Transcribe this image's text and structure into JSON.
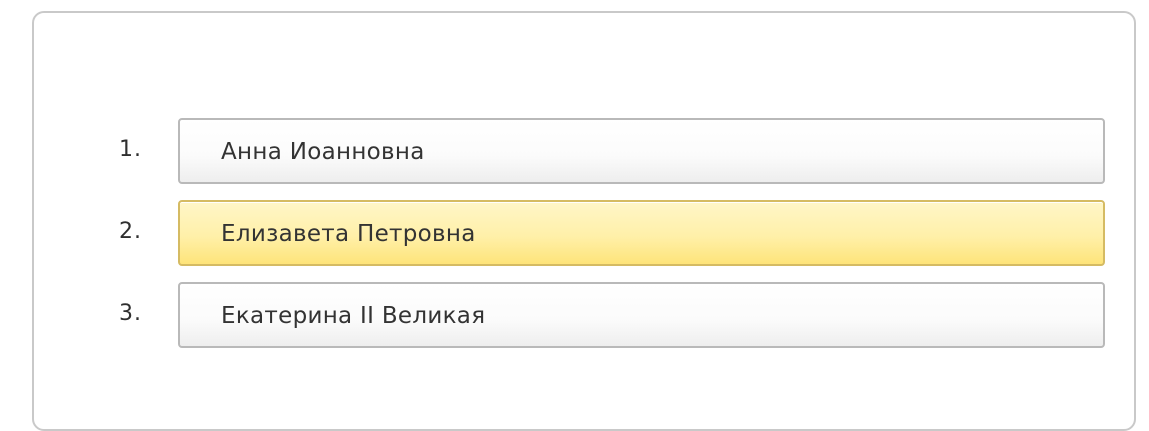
{
  "ordering_question": {
    "items": [
      {
        "number": "1.",
        "label": "Анна Иоанновна",
        "state": "default"
      },
      {
        "number": "2.",
        "label": "Елизавета Петровна",
        "state": "selected"
      },
      {
        "number": "3.",
        "label": "Екатерина II Великая",
        "state": "default"
      }
    ]
  },
  "colors": {
    "panel_border": "#c9c9c9",
    "button_border": "#b9b9b9",
    "selected_background": "#fff0a9",
    "selected_border": "#d5bb63",
    "text": "#333333"
  }
}
